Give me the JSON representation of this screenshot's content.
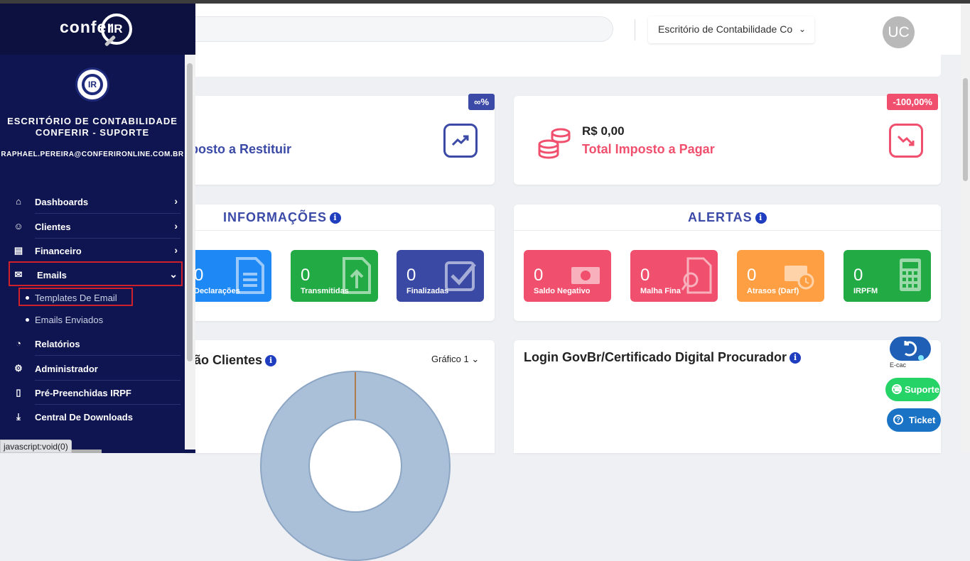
{
  "header": {
    "office_select": "Escritório de Contabilidade Co",
    "avatar_initials": "UC"
  },
  "brand": {
    "logo_text": "confer",
    "logo_mark": "IR"
  },
  "sidebar": {
    "org_logo_text": "IR",
    "org_name": "ESCRITÓRIO DE CONTABILIDADE CONFERIR - SUPORTE",
    "org_email": "RAPHAEL.PEREIRA@CONFERIRONLINE.COM.BR",
    "items": [
      {
        "label": "Dashboards",
        "icon": "home-icon"
      },
      {
        "label": "Clientes",
        "icon": "users-icon"
      },
      {
        "label": "Financeiro",
        "icon": "wallet-icon"
      },
      {
        "label": "Emails",
        "icon": "mail-icon",
        "expanded": true
      },
      {
        "label": "Relatórios",
        "icon": "pie-chart-icon"
      },
      {
        "label": "Administrador",
        "icon": "user-cog-icon"
      },
      {
        "label": "Pré-Preenchidas IRPF",
        "icon": "file-icon"
      },
      {
        "label": "Central De Downloads",
        "icon": "download-icon"
      }
    ],
    "email_subitems": [
      {
        "label": "Templates De Email",
        "highlighted": true
      },
      {
        "label": "Emails Enviados"
      }
    ]
  },
  "kpis": {
    "restituir": {
      "label": "posto a Restituir",
      "badge": "∞%",
      "color": "#3b4aa6"
    },
    "pagar": {
      "value": "R$ 0,00",
      "label": "Total Imposto a Pagar",
      "badge": "-100,00%",
      "color": "#f0506e"
    }
  },
  "informacoes": {
    "title": "INFORMAÇÕES",
    "tiles": [
      {
        "value": "0",
        "label": "Declarações",
        "color": "#1e88f5"
      },
      {
        "value": "0",
        "label": "Transmitidas",
        "color": "#22aa44"
      },
      {
        "value": "0",
        "label": "Finalizadas",
        "color": "#3a49a4"
      }
    ]
  },
  "alertas": {
    "title": "ALERTAS",
    "tiles": [
      {
        "value": "0",
        "label": "Saldo Negativo",
        "color": "#f0506e"
      },
      {
        "value": "0",
        "label": "Malha Fina",
        "color": "#f0506e"
      },
      {
        "value": "0",
        "label": "Atrasos (Darf)",
        "color": "#ff9f43"
      },
      {
        "value": "0",
        "label": "IRPFM",
        "color": "#22aa44"
      }
    ]
  },
  "clients_chart": {
    "title": "ão Clientes",
    "selector": "Gráfico 1"
  },
  "login_card": {
    "title": "Login GovBr/Certificado Digital Procurador"
  },
  "floating": {
    "ecac_label": "E-cac",
    "support_label": "Suporte",
    "ticket_label": "Ticket"
  },
  "status_bar": {
    "url": "javascript:void(0)"
  },
  "colors": {
    "sidebar_bg": "#0f1550",
    "primary": "#3b4aa6",
    "danger": "#f0506e",
    "success": "#22aa44",
    "warning": "#ff9f43"
  }
}
